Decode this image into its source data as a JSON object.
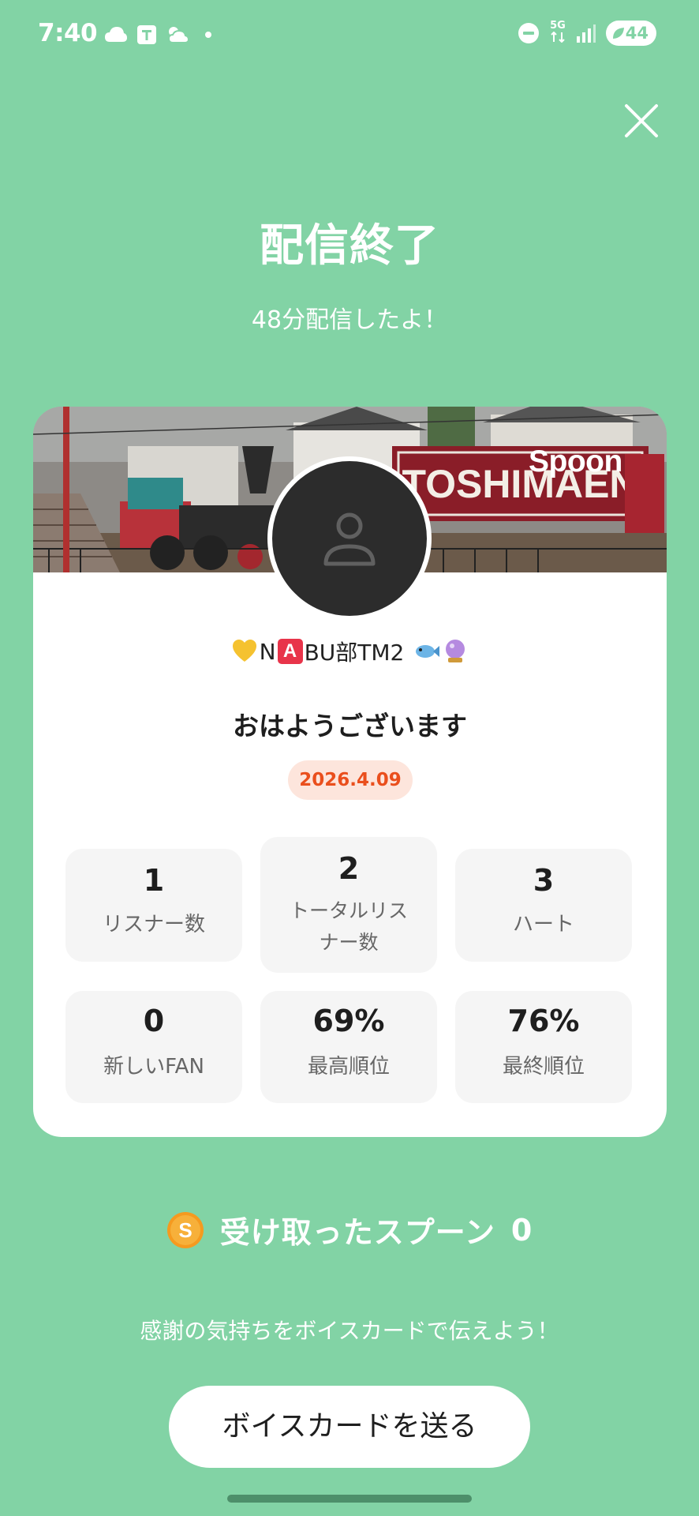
{
  "status_bar": {
    "time": "7:40",
    "left_icons": [
      "cloud-icon",
      "t-app-icon",
      "partly-cloudy-icon",
      "dot-icon"
    ],
    "network": "5G",
    "battery_level": "44"
  },
  "close_icon": "close-icon",
  "title": "配信終了",
  "duration": "48分配信したよ！",
  "card": {
    "banner_logo": "Spoon",
    "banner_sign_text": "TOSHIMAEN",
    "avatar_icon": "person-icon",
    "username": {
      "prefix": "N",
      "badge": "A",
      "suffix": "BU部TM2"
    },
    "broadcast_title": "おはようございます",
    "date": "2026.4.09",
    "stats": [
      {
        "value": "1",
        "label": "リスナー数"
      },
      {
        "value": "2",
        "label": "トータルリスナー数"
      },
      {
        "value": "3",
        "label": "ハート"
      },
      {
        "value": "0",
        "label": "新しいFAN"
      },
      {
        "value": "69%",
        "label": "最高順位"
      },
      {
        "value": "76%",
        "label": "最終順位"
      }
    ]
  },
  "spoon_received": {
    "label": "受け取ったスプーン",
    "count": "0",
    "icon": "spoon-coin-icon"
  },
  "thanks_message": "感謝の気持ちをボイスカードで伝えよう！",
  "voice_card_button": "ボイスカードを送る",
  "colors": {
    "background": "#82d3a5",
    "date_text": "#ea4f1d",
    "date_bg": "#fde5dc"
  }
}
